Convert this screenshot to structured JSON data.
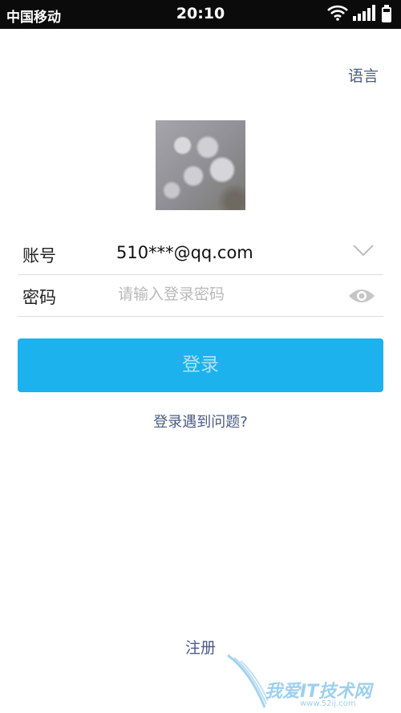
{
  "status_bar": {
    "carrier": "中国移动",
    "time": "20:10",
    "battery_level": 0.75
  },
  "header": {
    "language_link": "语言"
  },
  "login_form": {
    "account": {
      "label": "账号",
      "value": "510***@qq.com"
    },
    "password": {
      "label": "密码",
      "placeholder": "请输入登录密码"
    },
    "login_button": "登录",
    "accent_color": "#1bb2ee"
  },
  "links": {
    "problem": "登录遇到问题?",
    "register": "注册",
    "link_color": "#4a5b86"
  },
  "watermark": {
    "text": "我爱IT技术网",
    "url": "www.52ij.com"
  },
  "icons": [
    "wifi-icon",
    "signal-icon",
    "battery-icon",
    "chevron-down-icon",
    "eye-icon"
  ]
}
